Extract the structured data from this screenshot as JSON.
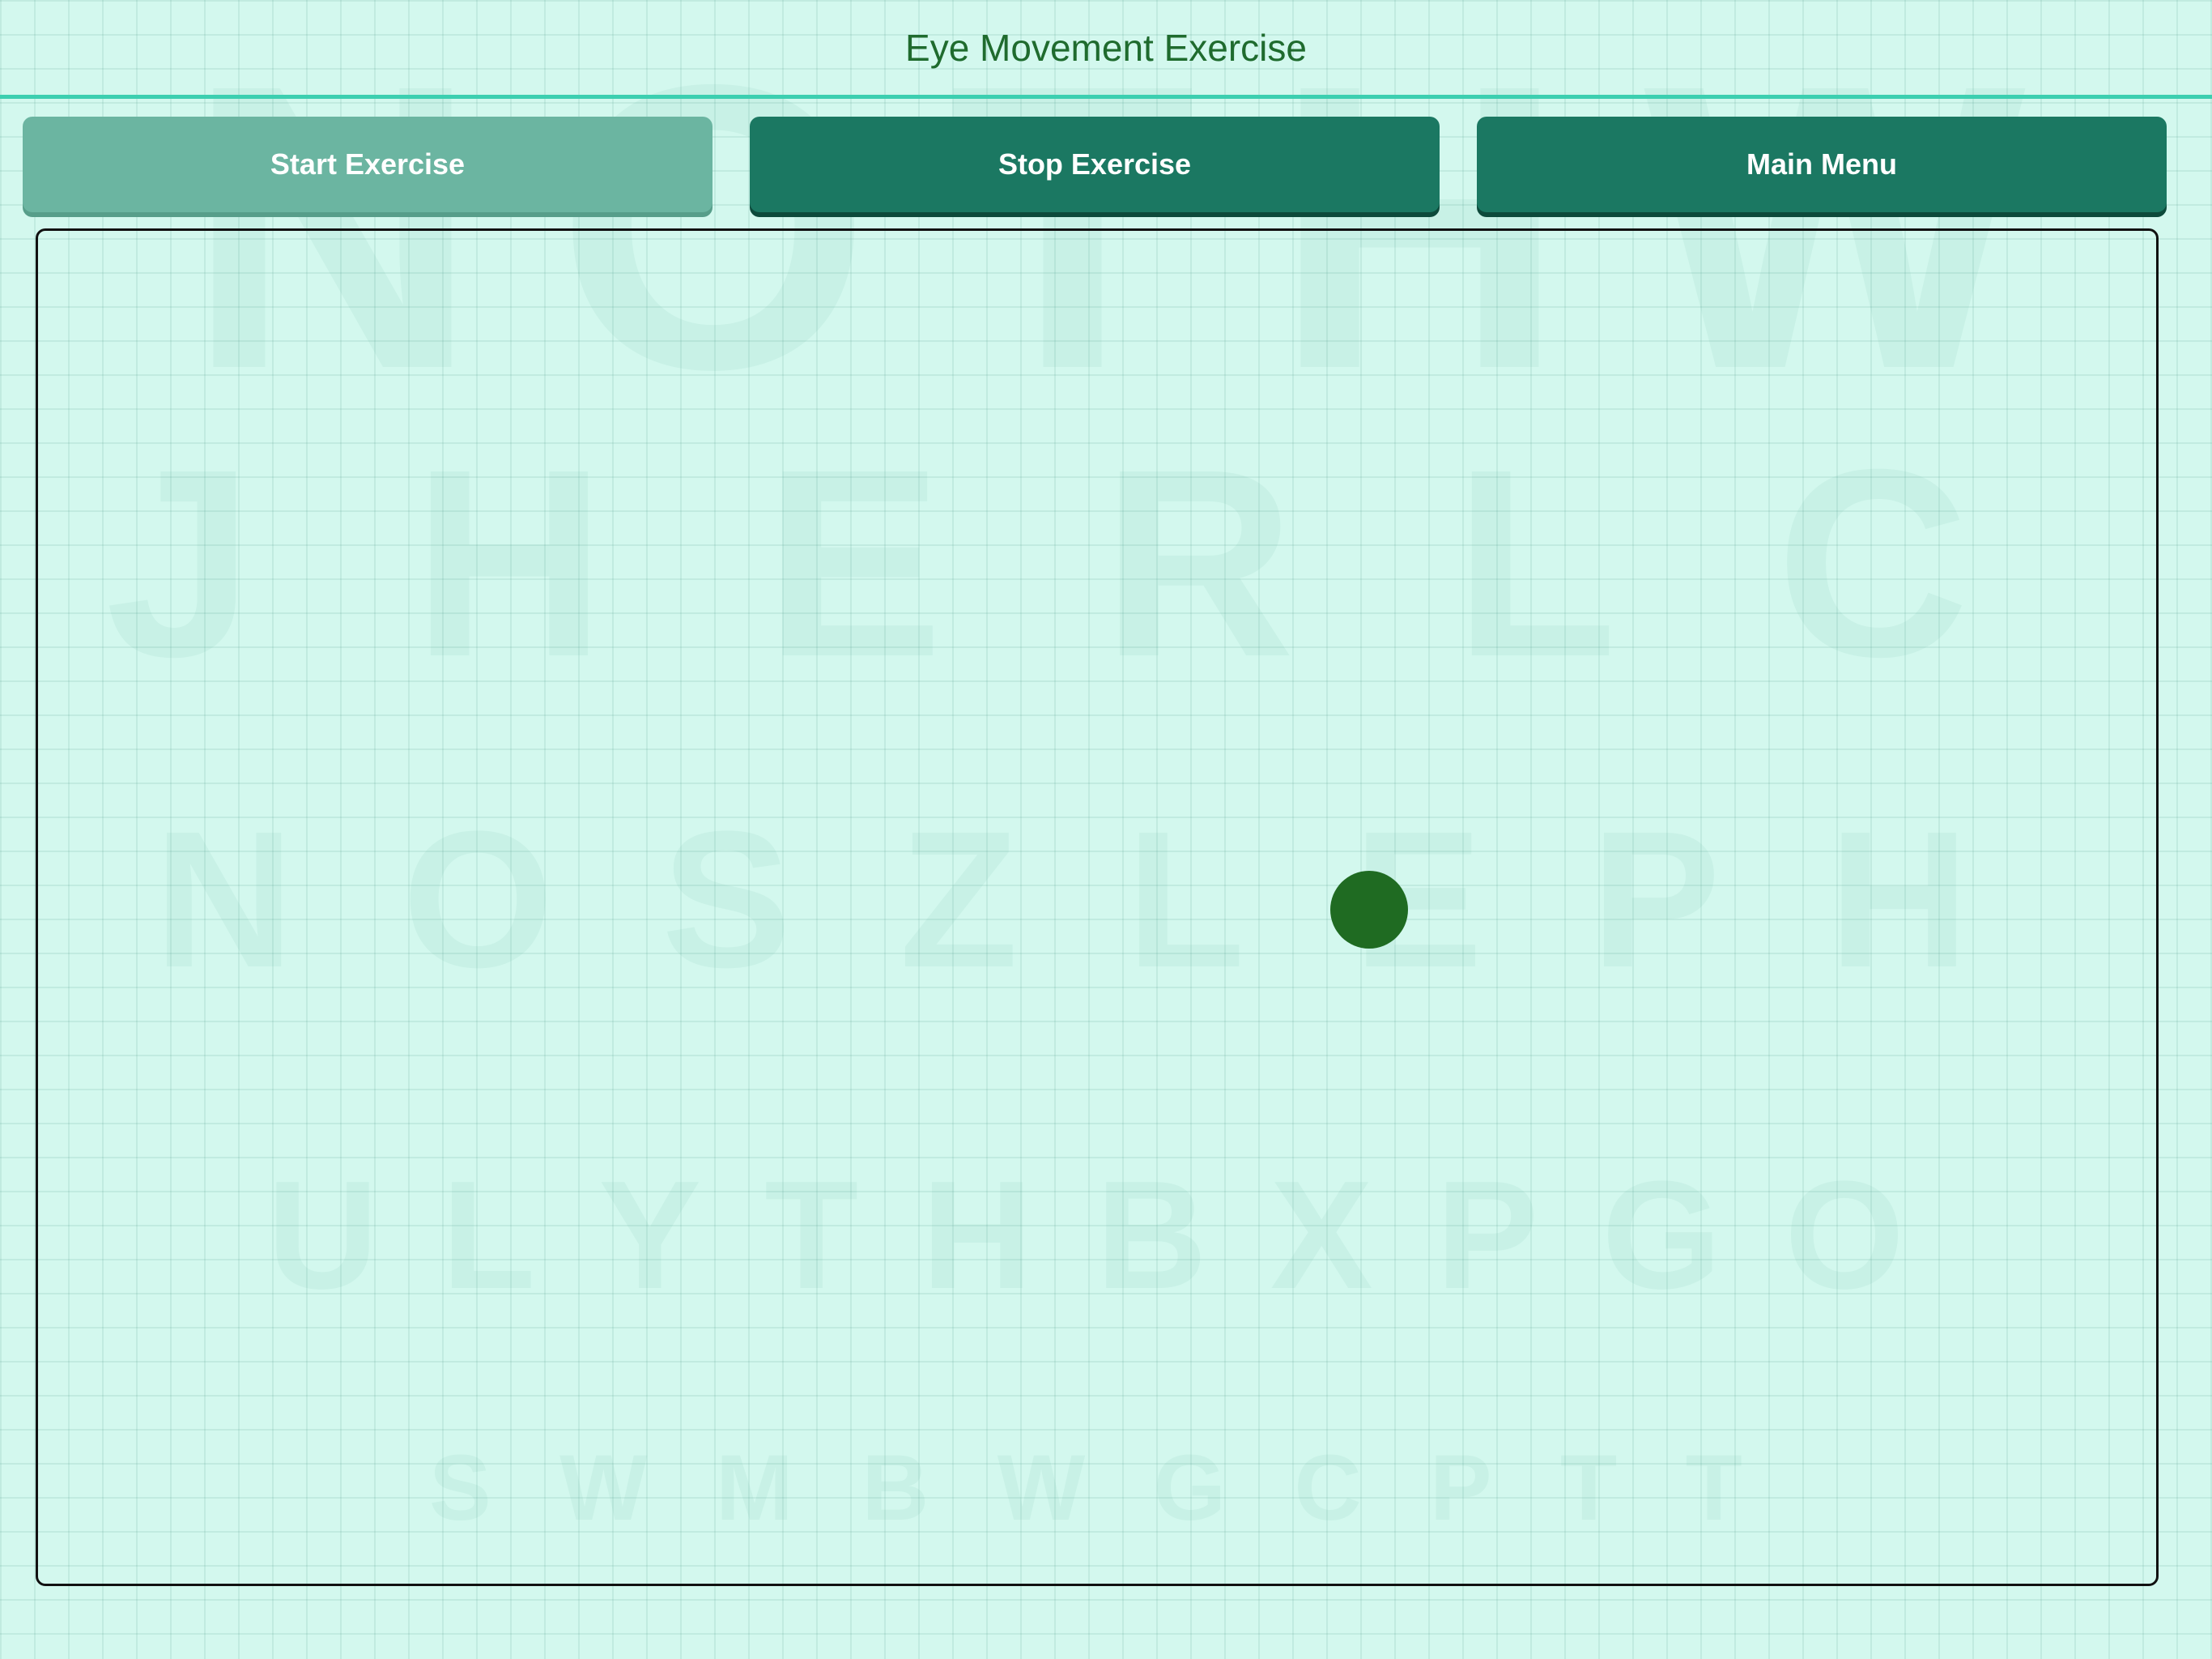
{
  "header": {
    "title": "Eye Movement Exercise"
  },
  "toolbar": {
    "start_label": "Start Exercise",
    "stop_label": "Stop Exercise",
    "menu_label": "Main Menu"
  },
  "background_chart": {
    "rows": [
      [
        "N",
        "O",
        "T",
        "H",
        "W"
      ],
      [
        "J",
        "H",
        "E",
        "R",
        "L",
        "C"
      ],
      [
        "N",
        "O",
        "S",
        "Z",
        "L",
        "E",
        "P",
        "H"
      ],
      [
        "U",
        "L",
        "Y",
        "T",
        "H",
        "B",
        "X",
        "P",
        "G",
        "O"
      ],
      [
        "S",
        "W",
        "M",
        "B",
        "W",
        "G",
        "C",
        "P",
        "T",
        "T"
      ]
    ]
  },
  "colors": {
    "background": "#d3f8ee",
    "title_text": "#1f6b2e",
    "divider": "#3ccfb0",
    "start_button": "#6bb5a1",
    "active_button": "#1b7862",
    "target_dot": "#1f6b22"
  }
}
